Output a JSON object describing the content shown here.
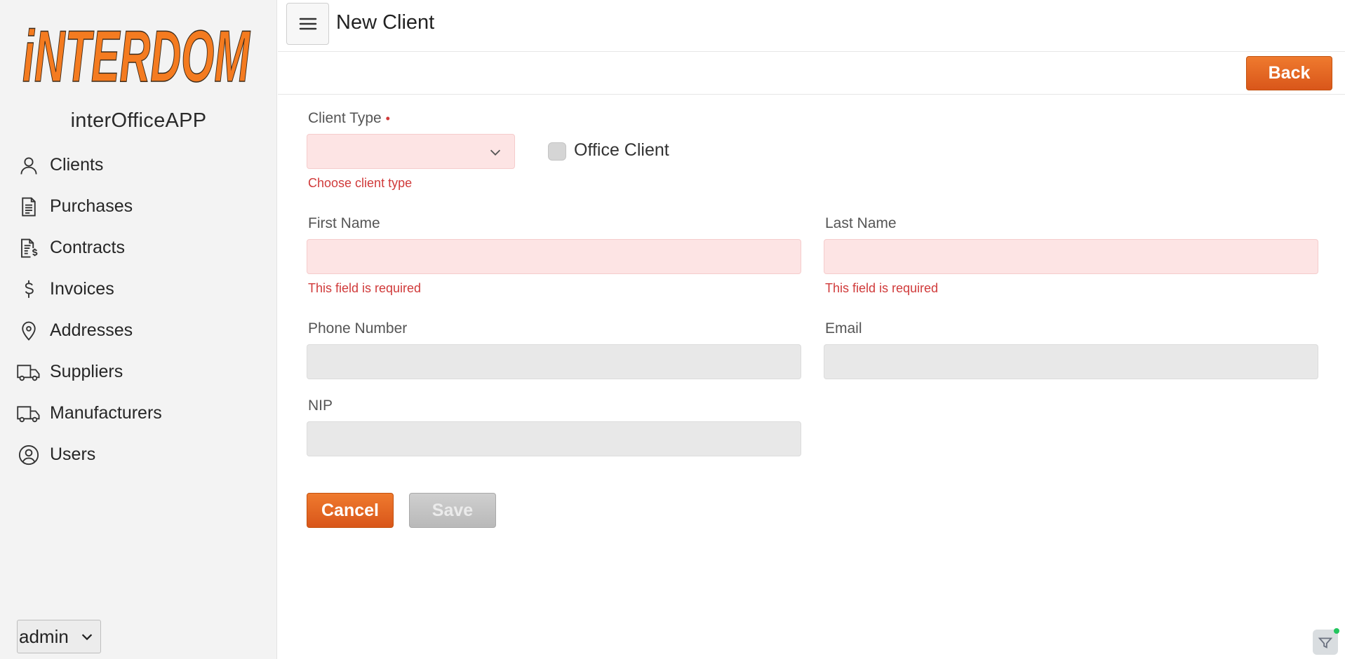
{
  "brand": {
    "logo_text": "iNTERDOM",
    "app_name": "interOfficeAPP",
    "logo_color": "#f47b20"
  },
  "sidebar": {
    "items": [
      {
        "label": "Clients",
        "icon": "user-icon"
      },
      {
        "label": "Purchases",
        "icon": "receipt-icon"
      },
      {
        "label": "Contracts",
        "icon": "contract-dollar-icon"
      },
      {
        "label": "Invoices",
        "icon": "dollar-icon"
      },
      {
        "label": "Addresses",
        "icon": "map-pin-icon"
      },
      {
        "label": "Suppliers",
        "icon": "truck-icon"
      },
      {
        "label": "Manufacturers",
        "icon": "truck-icon"
      },
      {
        "label": "Users",
        "icon": "user-circle-icon"
      }
    ],
    "user_select": {
      "value": "admin"
    }
  },
  "header": {
    "title": "New Client",
    "menu_icon": "hamburger-icon"
  },
  "toolbar": {
    "back_label": "Back"
  },
  "form": {
    "client_type": {
      "label": "Client Type",
      "required_marker": "•",
      "value": "",
      "error": "Choose client type"
    },
    "office_client": {
      "label": "Office Client",
      "checked": false
    },
    "first_name": {
      "label": "First Name",
      "value": "",
      "error": "This field is required"
    },
    "last_name": {
      "label": "Last Name",
      "value": "",
      "error": "This field is required"
    },
    "phone": {
      "label": "Phone Number",
      "value": ""
    },
    "email": {
      "label": "Email",
      "value": ""
    },
    "nip": {
      "label": "NIP",
      "value": ""
    },
    "cancel_label": "Cancel",
    "save_label": "Save"
  },
  "colors": {
    "accent": "#e8661f",
    "error": "#d03a3a",
    "invalid_bg": "#fde4e4"
  }
}
